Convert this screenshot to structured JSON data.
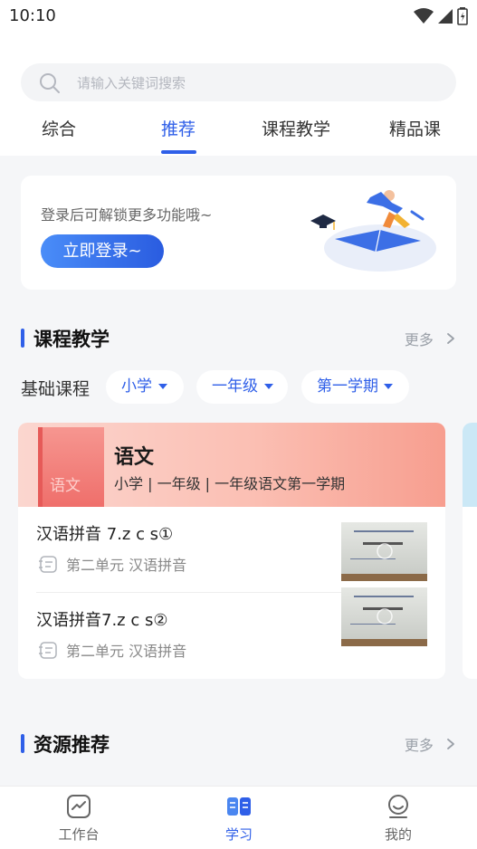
{
  "status": {
    "time": "10:10"
  },
  "search": {
    "placeholder": "请输入关键词搜索"
  },
  "tabs": [
    {
      "label": "综合"
    },
    {
      "label": "推荐",
      "active": true
    },
    {
      "label": "课程教学"
    },
    {
      "label": "精品课"
    }
  ],
  "login_card": {
    "text": "登录后可解锁更多功能哦~",
    "button": "立即登录~"
  },
  "course_section": {
    "title": "课程教学",
    "more": "更多",
    "filter_label": "基础课程",
    "filters": [
      "小学",
      "一年级",
      "第一学期"
    ]
  },
  "course": {
    "book_text": "语文",
    "title": "语文",
    "subtitle": "小学 | 一年级 | 一年级语文第一学期",
    "lessons": [
      {
        "title": "汉语拼音 7.z c s①",
        "meta": "第二单元 汉语拼音"
      },
      {
        "title": "汉语拼音7.z c s②",
        "meta": "第二单元 汉语拼音"
      }
    ]
  },
  "resource_section": {
    "title": "资源推荐",
    "more": "更多"
  },
  "bottom_nav": [
    {
      "label": "工作台",
      "icon": "workbench-icon"
    },
    {
      "label": "学习",
      "icon": "book-icon",
      "active": true
    },
    {
      "label": "我的",
      "icon": "profile-icon"
    }
  ],
  "colors": {
    "accent": "#2f5fe8",
    "background": "#f5f6f8"
  }
}
